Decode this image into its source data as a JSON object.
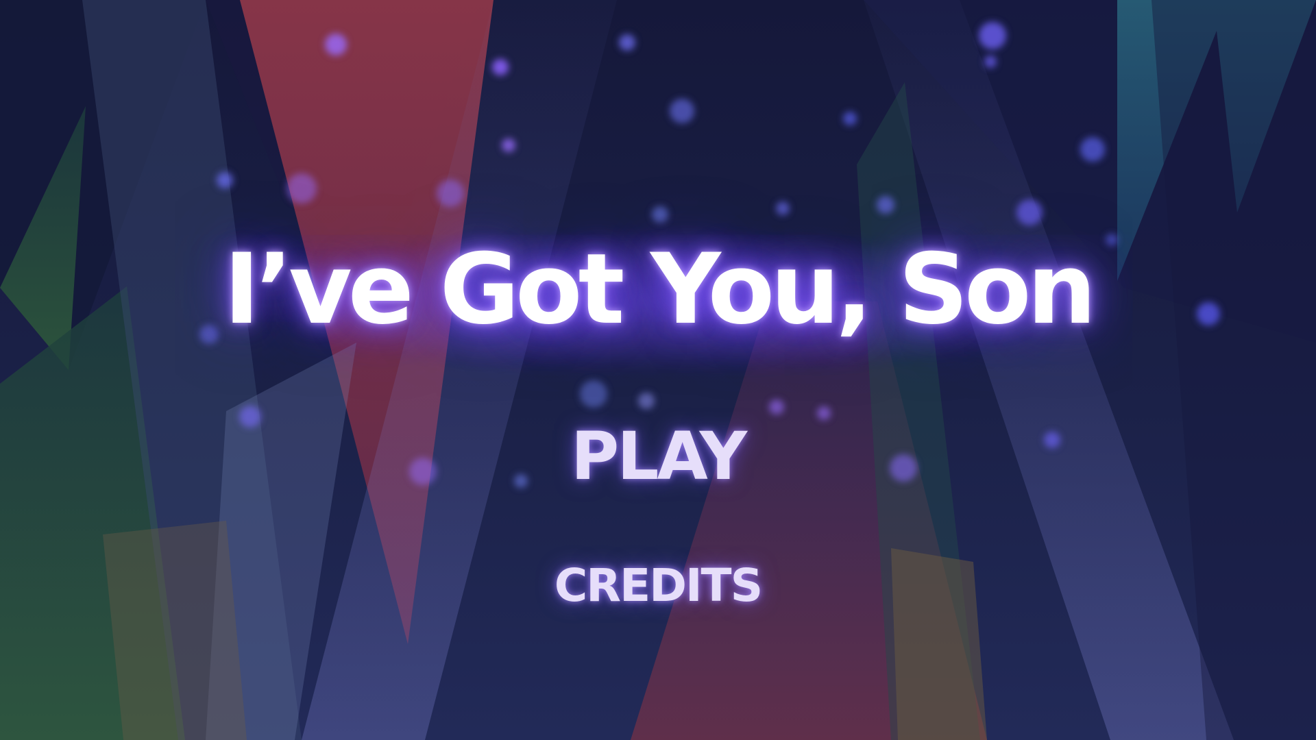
{
  "game": {
    "title": "I’ve Got You, Son"
  },
  "menu": {
    "items": [
      {
        "id": "play",
        "label": "PLAY"
      },
      {
        "id": "credits",
        "label": "CREDITS"
      }
    ]
  },
  "theme": {
    "background": "#161638",
    "title_color": "#ffffff",
    "menu_color": "#e6defa",
    "glow_color": "#7a55ff"
  }
}
